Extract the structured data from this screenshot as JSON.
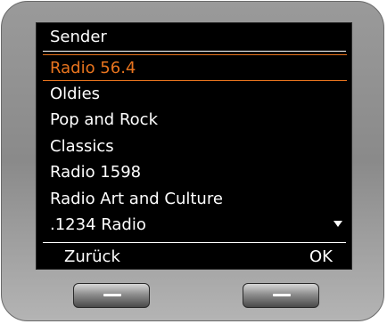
{
  "header": {
    "title": "Sender"
  },
  "list": {
    "items": [
      {
        "label": "Radio 56.4",
        "selected": true
      },
      {
        "label": "Oldies",
        "selected": false
      },
      {
        "label": "Pop and Rock",
        "selected": false
      },
      {
        "label": "Classics",
        "selected": false
      },
      {
        "label": "Radio 1598",
        "selected": false
      },
      {
        "label": "Radio Art and Culture",
        "selected": false
      },
      {
        "label": ".1234 Radio",
        "selected": false
      }
    ]
  },
  "softkeys": {
    "left_label": "Zurück",
    "right_label": "OK"
  },
  "icons": {
    "scroll": "triangle-down-icon",
    "left_button": "dash-icon",
    "right_button": "dash-icon"
  },
  "colors": {
    "screen": "#000000",
    "text": "#ffffff",
    "highlight": "#e8741e"
  }
}
